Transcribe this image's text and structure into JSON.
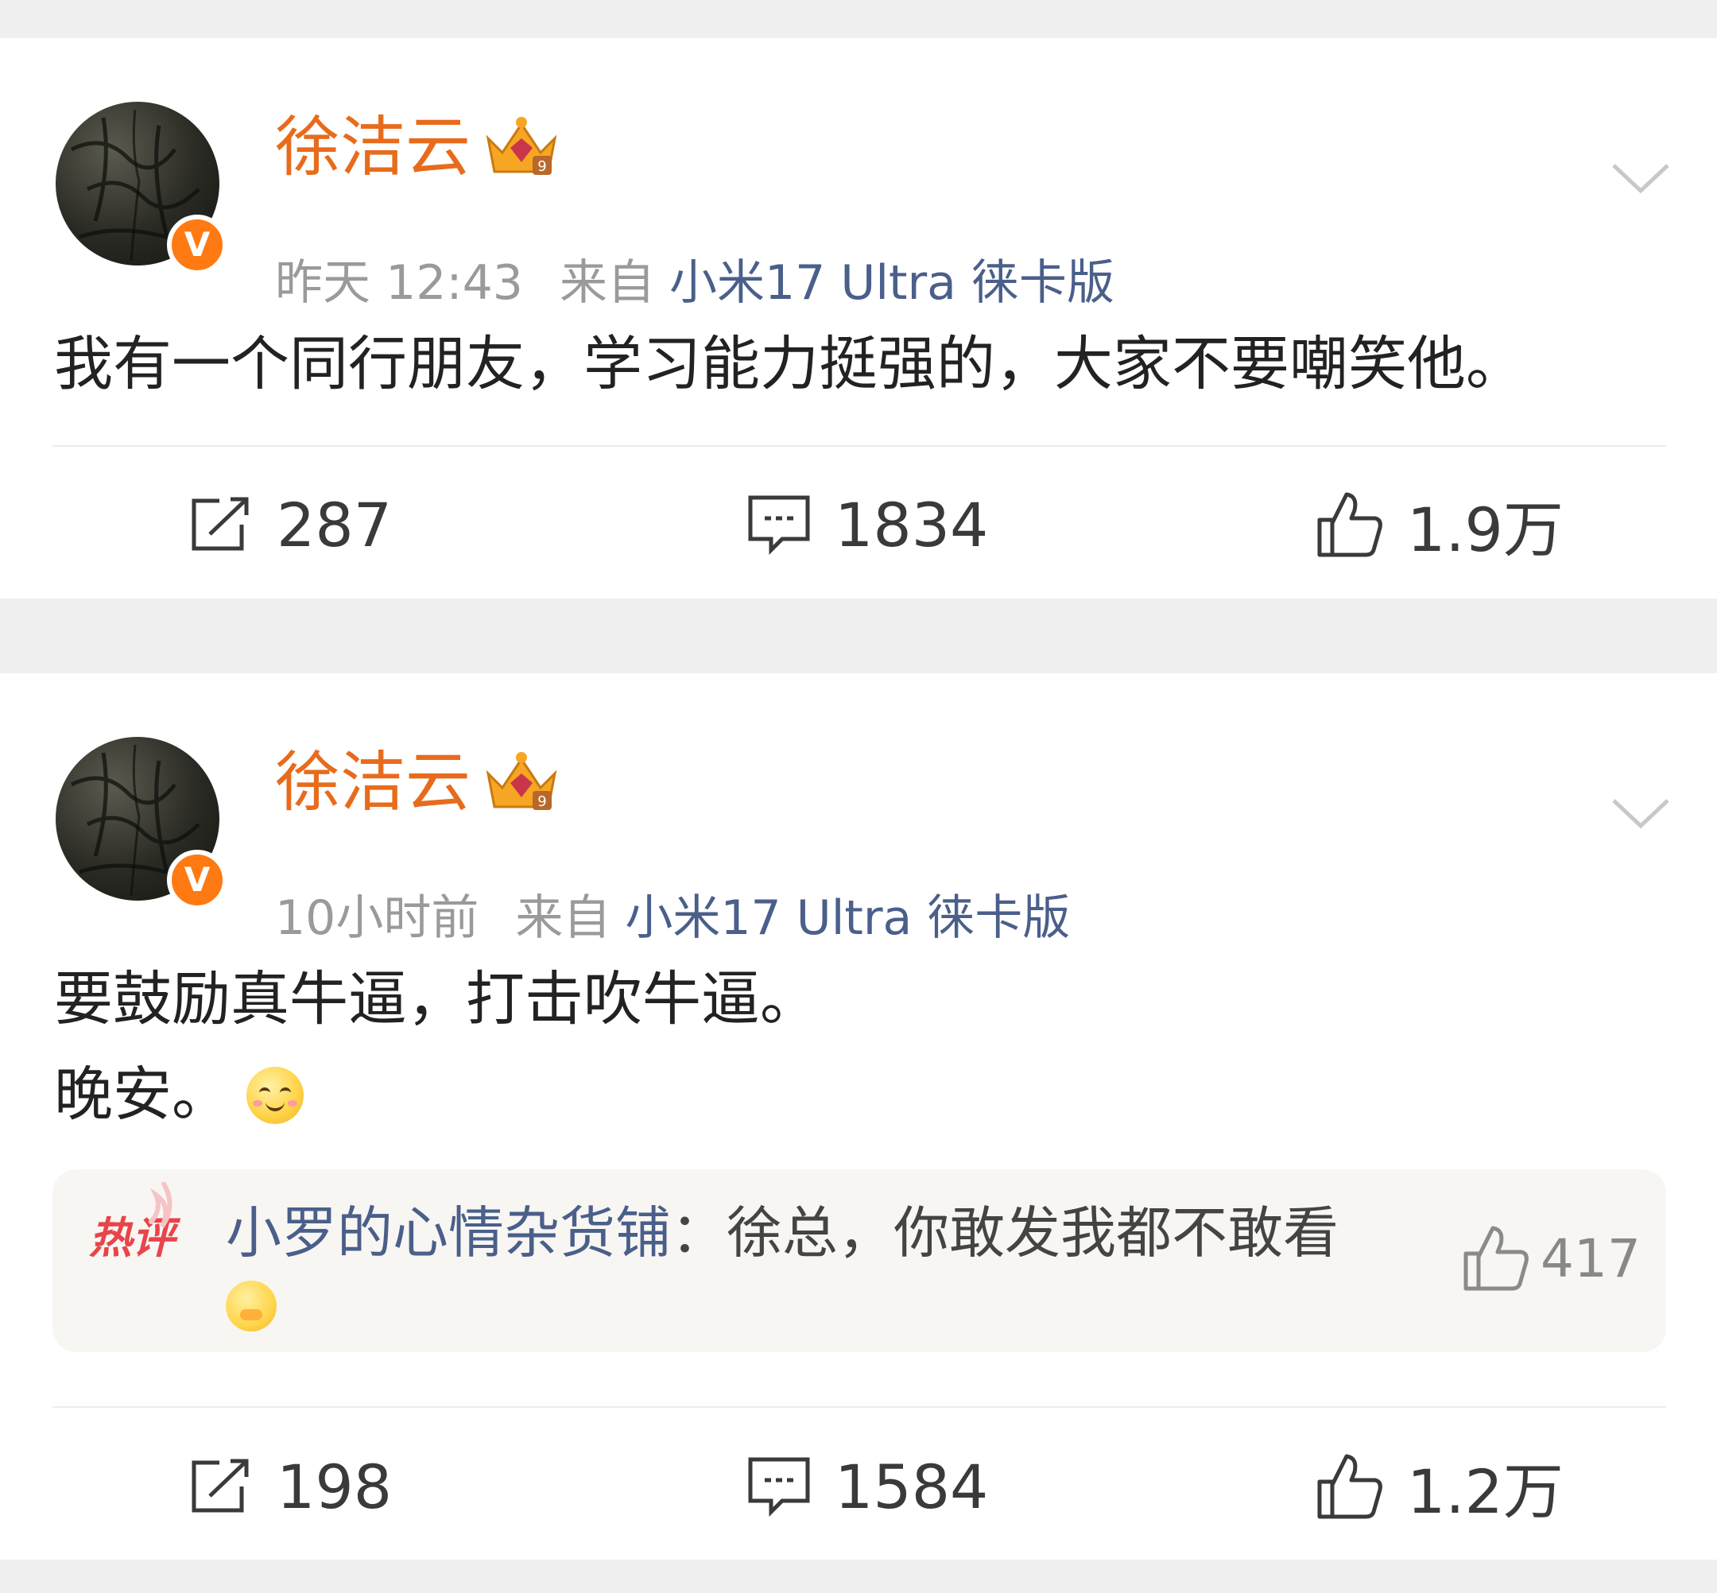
{
  "posts": [
    {
      "author": "徐洁云",
      "time": "昨天 12:43",
      "source_label": "来自",
      "device": "小米17 Ultra 徕卡版",
      "content_lines": [
        "我有一个同行朋友，学习能力挺强的，大家不要嘲笑他。"
      ],
      "reposts": "287",
      "comments": "1834",
      "likes": "1.9万"
    },
    {
      "author": "徐洁云",
      "time": "10小时前",
      "source_label": "来自",
      "device": "小米17 Ultra 徕卡版",
      "content_lines": [
        "要鼓励真牛逼，打击吹牛逼。",
        "晚安。"
      ],
      "hot_comment": {
        "tag": "热评",
        "user": "小罗的心情杂货铺",
        "separator": "：",
        "text": "徐总，你敢发我都不敢看",
        "likes": "417"
      },
      "reposts": "198",
      "comments": "1584",
      "likes": "1.2万"
    }
  ],
  "icons": {
    "verified": "V",
    "crown": "crown-badge-icon",
    "menu": "chevron-down-icon",
    "repost": "repost-icon",
    "comment": "comment-icon",
    "like": "thumbs-up-icon",
    "smile": "smile-emoji-icon",
    "cry": "crying-emoji-icon"
  },
  "colors": {
    "author": "#e86b1c",
    "device": "#4a5f8a",
    "verified": "#ff7a12",
    "hot_tag": "#e8444a"
  }
}
